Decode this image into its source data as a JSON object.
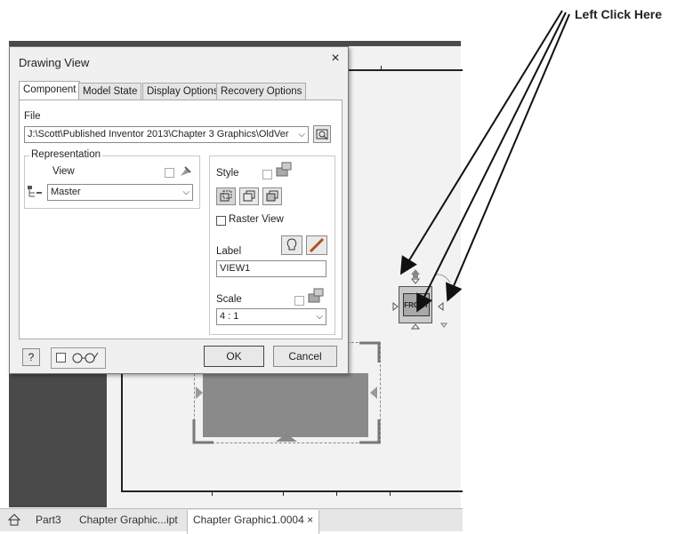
{
  "dialog": {
    "title": "Drawing View",
    "close_glyph": "×",
    "tabs": [
      "Component",
      "Model State",
      "Display Options",
      "Recovery Options"
    ],
    "file_label": "File",
    "file_path": "J:\\Scott\\Published Inventor 2013\\Chapter 3 Graphics\\OldVer",
    "representation_label": "Representation",
    "view_label": "View",
    "view_value": "Master",
    "style_label": "Style",
    "raster_label": "Raster View",
    "label_label": "Label",
    "label_value": "VIEW1",
    "scale_label": "Scale",
    "scale_value": "4 : 1",
    "ok": "OK",
    "cancel": "Cancel",
    "help_glyph": "?",
    "glasses_glyph": "♁"
  },
  "viewcube": {
    "face": "FRONT"
  },
  "statusbar": {
    "tabs": [
      "Part3",
      "Chapter Graphic...ipt",
      "Chapter Graphic1.0004 ×"
    ]
  },
  "callout": {
    "text": "Left Click Here"
  }
}
